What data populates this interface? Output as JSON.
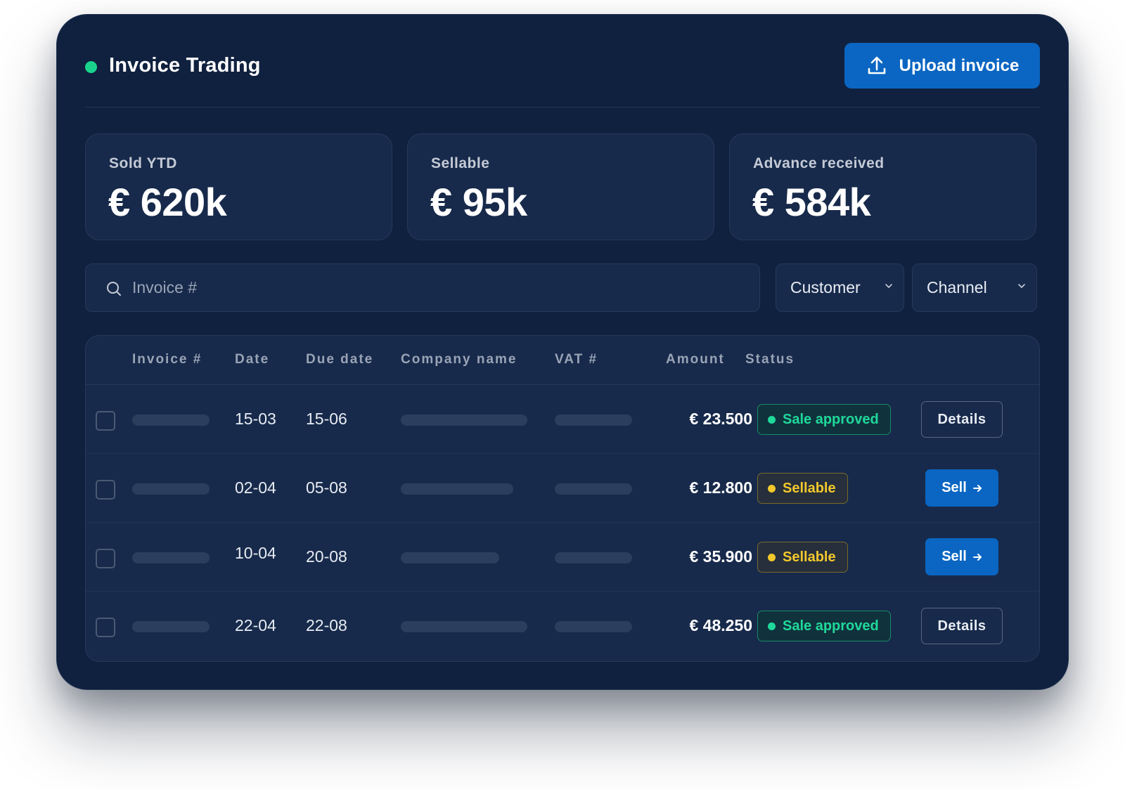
{
  "app": {
    "title": "Invoice Trading",
    "status_color": "#19d38d",
    "upload_label": "Upload invoice"
  },
  "stats": [
    {
      "label": "Sold YTD",
      "value": "€ 620k"
    },
    {
      "label": "Sellable",
      "value": "€ 95k"
    },
    {
      "label": "Advance received",
      "value": "€ 584k"
    }
  ],
  "filters": {
    "search_placeholder": "Invoice #",
    "customer_label": "Customer",
    "channel_label": "Channel"
  },
  "table": {
    "columns": [
      "Invoice #",
      "Date",
      "Due date",
      "Company name",
      "VAT #",
      "Amount",
      "Status"
    ],
    "rows": [
      {
        "date": "15-03",
        "due": "15-06",
        "amount": "€ 23.500",
        "status": "Sale approved",
        "action": "Details"
      },
      {
        "date": "02-04",
        "due": "05-08",
        "amount": "€ 12.800",
        "status": "Sellable",
        "action": "Sell"
      },
      {
        "date": "10-04",
        "due": "20-08",
        "amount": "€ 35.900",
        "status": "Sellable",
        "action": "Sell"
      },
      {
        "date": "22-04",
        "due": "22-08",
        "amount": "€ 48.250",
        "status": "Sale approved",
        "action": "Details"
      }
    ]
  },
  "colors": {
    "card_bg": "#10213f",
    "primary": "#0a66c2",
    "approved": "#1fd99a",
    "sellable": "#f4c82c"
  },
  "icons": {
    "upload": "upload-icon",
    "search": "search-icon",
    "chevron": "chevron-down-icon",
    "arrow": "arrow-right-icon"
  }
}
